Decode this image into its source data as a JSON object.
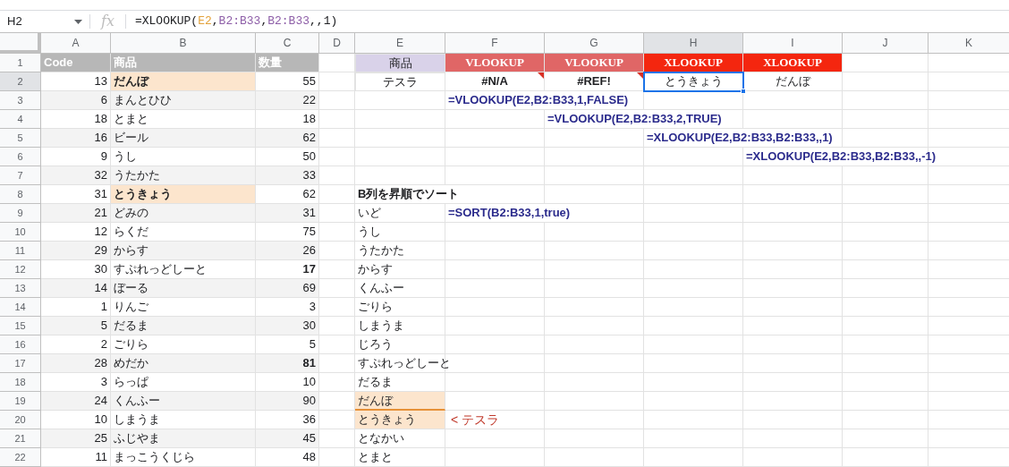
{
  "name_box": "H2",
  "function_label": "fx",
  "formula_parts": [
    {
      "text": "=XLOOKUP("
    },
    {
      "text": "E2",
      "color": "#e3a23b"
    },
    {
      "text": ","
    },
    {
      "text": "B2:B33",
      "color": "#8e5fa8"
    },
    {
      "text": ","
    },
    {
      "text": "B2:B33",
      "color": "#8e5fa8"
    },
    {
      "text": ",,1)"
    }
  ],
  "columns": [
    {
      "label": "A",
      "selected": false
    },
    {
      "label": "B",
      "selected": false
    },
    {
      "label": "C",
      "selected": false
    },
    {
      "label": "D",
      "selected": false
    },
    {
      "label": "E",
      "selected": false
    },
    {
      "label": "F",
      "selected": false
    },
    {
      "label": "G",
      "selected": false
    },
    {
      "label": "H",
      "selected": true
    },
    {
      "label": "I",
      "selected": false
    },
    {
      "label": "J",
      "selected": false
    },
    {
      "label": "K",
      "selected": false
    }
  ],
  "rows": [
    {
      "number": "1",
      "selected": false,
      "A": {
        "text": "Code",
        "kind": "header-gray",
        "bold": true
      },
      "B": {
        "text": "商品",
        "kind": "header-gray",
        "bold": true
      },
      "C": {
        "text": "数量",
        "kind": "header-gray",
        "bold": true
      },
      "E": {
        "text": "商品",
        "kind": "header-purple",
        "bold": false
      },
      "F": {
        "text": "VLOOKUP",
        "kind": "header-vlookup",
        "bold": true
      },
      "G": {
        "text": "VLOOKUP",
        "kind": "header-vlookup",
        "bold": true
      },
      "H": {
        "text": "XLOOKUP",
        "kind": "header-xlookup",
        "bold": true
      },
      "I": {
        "text": "XLOOKUP",
        "kind": "header-xlookup",
        "bold": true
      }
    },
    {
      "number": "2",
      "selected": true,
      "A": {
        "text": "13",
        "kind": "number",
        "bold": false
      },
      "B": {
        "text": "だんぼ",
        "kind": "highlight",
        "bold": true
      },
      "C": {
        "text": "55",
        "kind": "number",
        "bold": false
      },
      "E": {
        "text": "テスラ",
        "kind": "input",
        "bold": false
      },
      "F": {
        "text": "#N/A",
        "kind": "error",
        "bold": true
      },
      "G": {
        "text": "#REF!",
        "kind": "error",
        "bold": true
      },
      "H": {
        "text": "とうきょう",
        "kind": "center",
        "bold": false
      },
      "I": {
        "text": "だんぼ",
        "kind": "center",
        "bold": false
      }
    },
    {
      "number": "3",
      "selected": false,
      "A": {
        "text": "6",
        "kind": "number",
        "bold": false
      },
      "B": {
        "text": "まんとひひ",
        "kind": "text",
        "bold": false
      },
      "C": {
        "text": "22",
        "kind": "number",
        "bold": false
      },
      "F": {
        "text": "=VLOOKUP(E2,B2:B33,1,FALSE)",
        "kind": "formula",
        "bold": true
      }
    },
    {
      "number": "4",
      "selected": false,
      "A": {
        "text": "18",
        "kind": "number",
        "bold": false
      },
      "B": {
        "text": "とまと",
        "kind": "text",
        "bold": false
      },
      "C": {
        "text": "18",
        "kind": "number",
        "bold": false
      },
      "G": {
        "text": "=VLOOKUP(E2,B2:B33,2,TRUE)",
        "kind": "formula",
        "bold": true
      }
    },
    {
      "number": "5",
      "selected": false,
      "A": {
        "text": "16",
        "kind": "number",
        "bold": false
      },
      "B": {
        "text": "ビール",
        "kind": "text",
        "bold": false
      },
      "C": {
        "text": "62",
        "kind": "number",
        "bold": false
      },
      "H": {
        "text": "=XLOOKUP(E2,B2:B33,B2:B33,,1)",
        "kind": "formula",
        "bold": true
      }
    },
    {
      "number": "6",
      "selected": false,
      "A": {
        "text": "9",
        "kind": "number",
        "bold": false
      },
      "B": {
        "text": "うし",
        "kind": "text",
        "bold": false
      },
      "C": {
        "text": "50",
        "kind": "number",
        "bold": false
      },
      "I": {
        "text": "=XLOOKUP(E2,B2:B33,B2:B33,,-1)",
        "kind": "formula",
        "bold": true
      }
    },
    {
      "number": "7",
      "selected": false,
      "A": {
        "text": "32",
        "kind": "number",
        "bold": false
      },
      "B": {
        "text": "うたかた",
        "kind": "text",
        "bold": false
      },
      "C": {
        "text": "33",
        "kind": "number",
        "bold": false
      }
    },
    {
      "number": "8",
      "selected": false,
      "A": {
        "text": "31",
        "kind": "number",
        "bold": false
      },
      "B": {
        "text": "とうきょう",
        "kind": "highlight",
        "bold": true
      },
      "C": {
        "text": "62",
        "kind": "number",
        "bold": false
      },
      "E": {
        "text": "B列を昇順でソート",
        "kind": "label",
        "bold": true
      }
    },
    {
      "number": "9",
      "selected": false,
      "A": {
        "text": "21",
        "kind": "number",
        "bold": false
      },
      "B": {
        "text": "どみの",
        "kind": "text",
        "bold": false
      },
      "C": {
        "text": "31",
        "kind": "number",
        "bold": false
      },
      "E": {
        "text": "いど",
        "kind": "text",
        "bold": false
      },
      "F": {
        "text": "=SORT(B2:B33,1,true)",
        "kind": "formula",
        "bold": true
      }
    },
    {
      "number": "10",
      "selected": false,
      "A": {
        "text": "12",
        "kind": "number",
        "bold": false
      },
      "B": {
        "text": "らくだ",
        "kind": "text",
        "bold": false
      },
      "C": {
        "text": "75",
        "kind": "number",
        "bold": false
      },
      "E": {
        "text": "うし",
        "kind": "text",
        "bold": false
      }
    },
    {
      "number": "11",
      "selected": false,
      "A": {
        "text": "29",
        "kind": "number",
        "bold": false
      },
      "B": {
        "text": "からす",
        "kind": "text",
        "bold": false
      },
      "C": {
        "text": "26",
        "kind": "number",
        "bold": false
      },
      "E": {
        "text": "うたかた",
        "kind": "text",
        "bold": false
      }
    },
    {
      "number": "12",
      "selected": false,
      "A": {
        "text": "30",
        "kind": "number",
        "bold": false
      },
      "B": {
        "text": "すぷれっどしーと",
        "kind": "text",
        "bold": false
      },
      "C": {
        "text": "17",
        "kind": "number",
        "bold": true
      },
      "E": {
        "text": "からす",
        "kind": "text",
        "bold": false
      }
    },
    {
      "number": "13",
      "selected": false,
      "A": {
        "text": "14",
        "kind": "number",
        "bold": false
      },
      "B": {
        "text": "ぼーる",
        "kind": "text",
        "bold": false
      },
      "C": {
        "text": "69",
        "kind": "number",
        "bold": false
      },
      "E": {
        "text": "くんふー",
        "kind": "text",
        "bold": false
      }
    },
    {
      "number": "14",
      "selected": false,
      "A": {
        "text": "1",
        "kind": "number",
        "bold": false
      },
      "B": {
        "text": "りんご",
        "kind": "text",
        "bold": false
      },
      "C": {
        "text": "3",
        "kind": "number",
        "bold": false
      },
      "E": {
        "text": "ごりら",
        "kind": "text",
        "bold": false
      }
    },
    {
      "number": "15",
      "selected": false,
      "A": {
        "text": "5",
        "kind": "number",
        "bold": false
      },
      "B": {
        "text": "だるま",
        "kind": "text",
        "bold": false
      },
      "C": {
        "text": "30",
        "kind": "number",
        "bold": false
      },
      "E": {
        "text": "しまうま",
        "kind": "text",
        "bold": false
      }
    },
    {
      "number": "16",
      "selected": false,
      "A": {
        "text": "2",
        "kind": "number",
        "bold": false
      },
      "B": {
        "text": "ごりら",
        "kind": "text",
        "bold": false
      },
      "C": {
        "text": "5",
        "kind": "number",
        "bold": false
      },
      "E": {
        "text": "じろう",
        "kind": "text",
        "bold": false
      }
    },
    {
      "number": "17",
      "selected": false,
      "A": {
        "text": "28",
        "kind": "number",
        "bold": false
      },
      "B": {
        "text": "めだか",
        "kind": "text",
        "bold": false
      },
      "C": {
        "text": "81",
        "kind": "number",
        "bold": true
      },
      "E": {
        "text": "すぷれっどしーと",
        "kind": "text",
        "bold": false
      }
    },
    {
      "number": "18",
      "selected": false,
      "A": {
        "text": "3",
        "kind": "number",
        "bold": false
      },
      "B": {
        "text": "らっぱ",
        "kind": "text",
        "bold": false
      },
      "C": {
        "text": "10",
        "kind": "number",
        "bold": false
      },
      "E": {
        "text": "だるま",
        "kind": "text",
        "bold": false
      }
    },
    {
      "number": "19",
      "selected": false,
      "A": {
        "text": "24",
        "kind": "number",
        "bold": false
      },
      "B": {
        "text": "くんふー",
        "kind": "text",
        "bold": false
      },
      "C": {
        "text": "90",
        "kind": "number",
        "bold": false
      },
      "E": {
        "text": "だんぼ",
        "kind": "highlight-ruled",
        "bold": false
      }
    },
    {
      "number": "20",
      "selected": false,
      "A": {
        "text": "10",
        "kind": "number",
        "bold": false
      },
      "B": {
        "text": "しまうま",
        "kind": "text",
        "bold": false
      },
      "C": {
        "text": "36",
        "kind": "number",
        "bold": false
      },
      "E": {
        "text": "とうきょう",
        "kind": "highlight",
        "bold": false
      },
      "F": {
        "text": "< テスラ",
        "kind": "note",
        "bold": false
      }
    },
    {
      "number": "21",
      "selected": false,
      "A": {
        "text": "25",
        "kind": "number",
        "bold": false
      },
      "B": {
        "text": "ふじやま",
        "kind": "text",
        "bold": false
      },
      "C": {
        "text": "45",
        "kind": "number",
        "bold": false
      },
      "E": {
        "text": "となかい",
        "kind": "text",
        "bold": false
      }
    },
    {
      "number": "22",
      "selected": false,
      "A": {
        "text": "11",
        "kind": "number",
        "bold": false
      },
      "B": {
        "text": "まっこうくじら",
        "kind": "text",
        "bold": false
      },
      "C": {
        "text": "48",
        "kind": "number",
        "bold": false
      },
      "E": {
        "text": "とまと",
        "kind": "text",
        "bold": false
      }
    }
  ]
}
